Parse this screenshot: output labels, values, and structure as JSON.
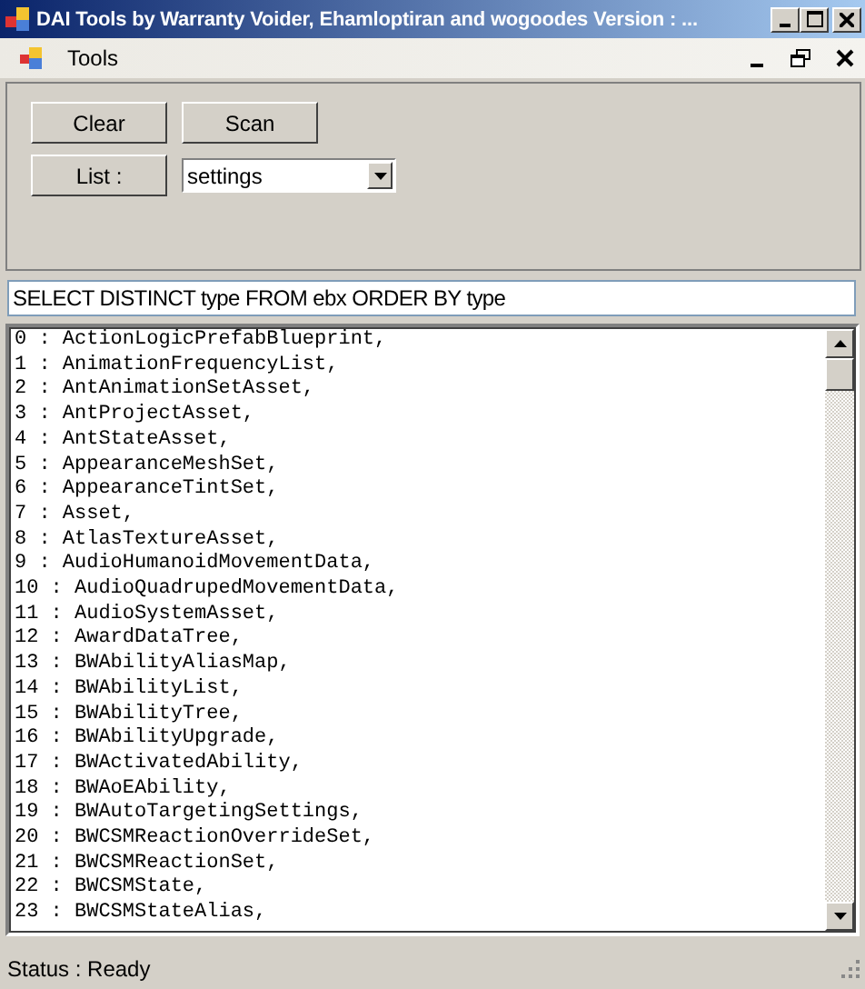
{
  "window": {
    "title": "DAI Tools by Warranty Voider, Ehamloptiran and wogoodes Version : ..."
  },
  "menu": {
    "items": [
      "Tools"
    ]
  },
  "buttons": {
    "clear": "Clear",
    "scan": "Scan",
    "list": "List :"
  },
  "dropdown": {
    "value": "settings"
  },
  "query": {
    "value": "SELECT DISTINCT type FROM ebx ORDER BY type"
  },
  "output": {
    "lines": [
      "0 : ActionLogicPrefabBlueprint,",
      "1 : AnimationFrequencyList,",
      "2 : AntAnimationSetAsset,",
      "3 : AntProjectAsset,",
      "4 : AntStateAsset,",
      "5 : AppearanceMeshSet,",
      "6 : AppearanceTintSet,",
      "7 : Asset,",
      "8 : AtlasTextureAsset,",
      "9 : AudioHumanoidMovementData,",
      "10 : AudioQuadrupedMovementData,",
      "11 : AudioSystemAsset,",
      "12 : AwardDataTree,",
      "13 : BWAbilityAliasMap,",
      "14 : BWAbilityList,",
      "15 : BWAbilityTree,",
      "16 : BWAbilityUpgrade,",
      "17 : BWActivatedAbility,",
      "18 : BWAoEAbility,",
      "19 : BWAutoTargetingSettings,",
      "20 : BWCSMReactionOverrideSet,",
      "21 : BWCSMReactionSet,",
      "22 : BWCSMState,",
      "23 : BWCSMStateAlias,"
    ]
  },
  "status_bar": {
    "text": "Status : Ready"
  }
}
